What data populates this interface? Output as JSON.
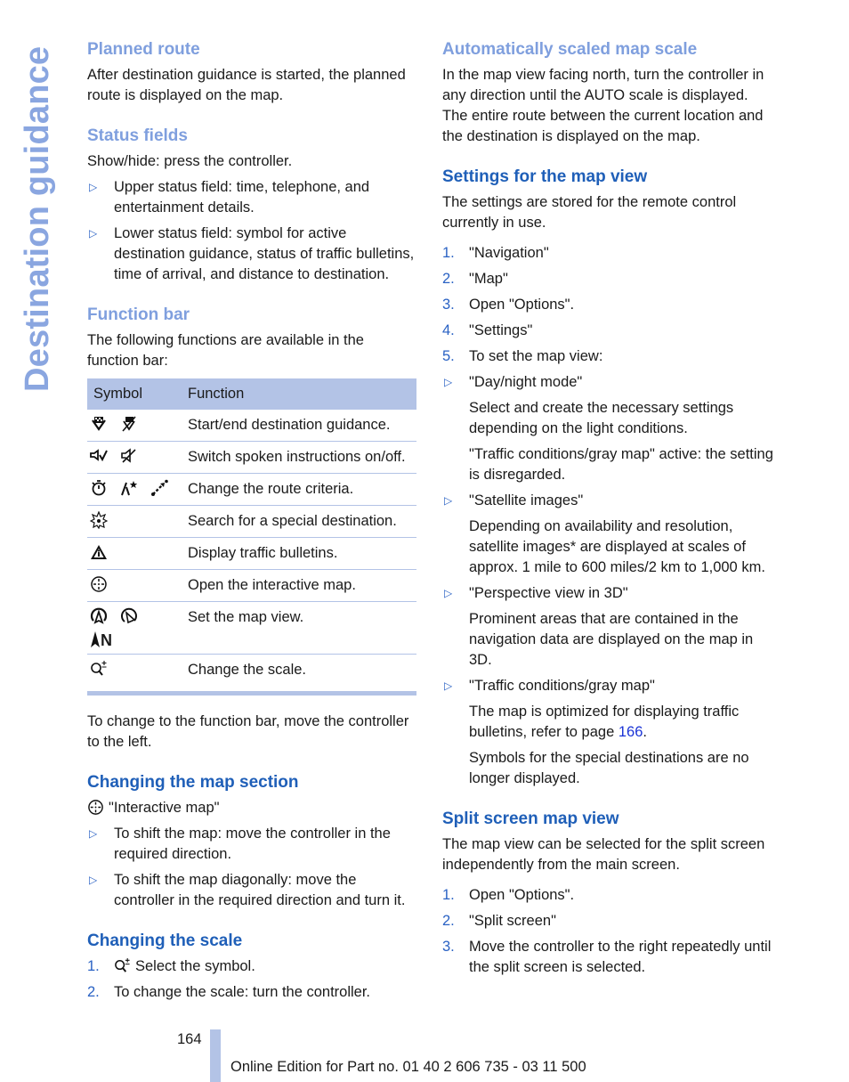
{
  "side_title": "Destination guidance",
  "left": {
    "planned_route": {
      "heading": "Planned route",
      "text": "After destination guidance is started, the planned route is displayed on the map."
    },
    "status_fields": {
      "heading": "Status fields",
      "text": "Show/hide: press the controller.",
      "bullets": [
        "Upper status field: time, telephone, and entertainment details.",
        "Lower status field: symbol for active destination guidance, status of traffic bulletins, time of arrival, and distance to destination."
      ]
    },
    "function_bar": {
      "heading": "Function bar",
      "text": "The following functions are available in the function bar:",
      "table": {
        "headers": [
          "Symbol",
          "Function"
        ],
        "rows": [
          {
            "icons": [
              "destination-guidance-start-icon",
              "destination-guidance-end-icon"
            ],
            "function": "Start/end destination guidance."
          },
          {
            "icons": [
              "voice-on-icon",
              "voice-off-icon"
            ],
            "function": "Switch spoken instructions on/off."
          },
          {
            "icons": [
              "stopwatch-icon",
              "road-star-icon",
              "route-arrow-icon"
            ],
            "function": "Change the route criteria."
          },
          {
            "icons": [
              "special-destination-icon"
            ],
            "function": "Search for a special destination."
          },
          {
            "icons": [
              "traffic-warning-icon"
            ],
            "function": "Display traffic bulletins."
          },
          {
            "icons": [
              "interactive-map-icon"
            ],
            "function": "Open the interactive map."
          },
          {
            "icons": [
              "map-direction-icon",
              "map-perspective-icon",
              "map-north-icon"
            ],
            "function": "Set the map view.",
            "north_label": "N"
          },
          {
            "icons": [
              "zoom-scale-icon"
            ],
            "function": "Change the scale."
          }
        ]
      },
      "after_text": "To change to the function bar, move the controller to the left."
    },
    "changing_map_section": {
      "heading": "Changing the map section",
      "menu_label": "\"Interactive map\"",
      "bullets": [
        "To shift the map: move the controller in the required direction.",
        "To shift the map diagonally: move the controller in the required direction and turn it."
      ]
    },
    "changing_scale": {
      "heading": "Changing the scale",
      "steps": [
        {
          "num": "1.",
          "text": "Select the symbol."
        },
        {
          "num": "2.",
          "text": "To change the scale: turn the controller."
        }
      ]
    }
  },
  "right": {
    "auto_scale": {
      "heading": "Automatically scaled map scale",
      "text": "In the map view facing north, turn the controller in any direction until the AUTO scale is displayed. The entire route between the current location and the destination is displayed on the map."
    },
    "settings": {
      "heading": "Settings for the map view",
      "text": "The settings are stored for the remote control currently in use.",
      "steps": [
        {
          "num": "1.",
          "text": "\"Navigation\""
        },
        {
          "num": "2.",
          "text": "\"Map\""
        },
        {
          "num": "3.",
          "text": "Open \"Options\"."
        },
        {
          "num": "4.",
          "text": "\"Settings\""
        },
        {
          "num": "5.",
          "text": "To set the map view:"
        }
      ],
      "options": [
        {
          "label": "\"Day/night mode\"",
          "paras": [
            "Select and create the necessary settings depending on the light conditions.",
            "\"Traffic conditions/gray map\" active: the setting is disregarded."
          ]
        },
        {
          "label": "\"Satellite images\"",
          "paras": [
            "Depending on availability and resolution, satellite images* are displayed at scales of approx. 1 mile to 600 miles/2 km to 1,000 km."
          ]
        },
        {
          "label": "\"Perspective view in 3D\"",
          "paras": [
            "Prominent areas that are contained in the navigation data are displayed on the map in 3D."
          ]
        },
        {
          "label": "\"Traffic conditions/gray map\"",
          "paras": [
            "The map is optimized for displaying traffic bulletins, refer to page ",
            "Symbols for the special destinations are no longer displayed."
          ],
          "page_ref": "166"
        }
      ]
    },
    "split_screen": {
      "heading": "Split screen map view",
      "text": "The map view can be selected for the split screen independently from the main screen.",
      "steps": [
        {
          "num": "1.",
          "text": "Open \"Options\"."
        },
        {
          "num": "2.",
          "text": "\"Split screen\""
        },
        {
          "num": "3.",
          "text": "Move the controller to the right repeatedly until the split screen is selected."
        }
      ]
    }
  },
  "footer": {
    "page_number": "164",
    "edition": "Online Edition for Part no. 01 40 2 606 735 - 03 11 500"
  },
  "colors": {
    "heading_blue": "#1f5fb8",
    "heading_light": "#7f9fde",
    "table_accent": "#b3c3e6",
    "side_title": "#8aa6e0",
    "link": "#1a33d6"
  },
  "bullet_marker": "▷"
}
